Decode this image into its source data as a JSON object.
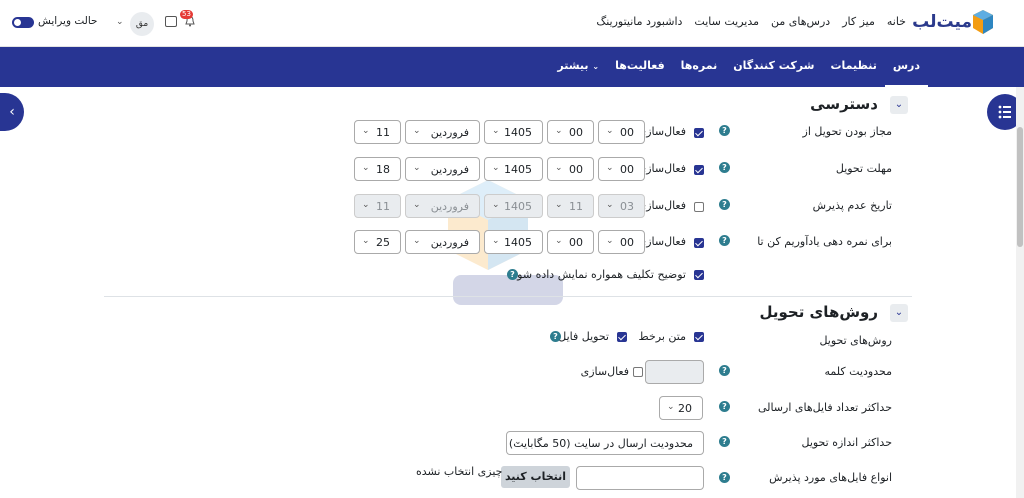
{
  "topbar": {
    "logo_text": "میت‌لب",
    "links": [
      "خانه",
      "میز کار",
      "درس‌های من",
      "مدیریت سایت",
      "داشبورد مانیتورینگ"
    ],
    "edit_mode_label": "حالت ویرایش",
    "avatar_initials": "مق",
    "notification_count": "53"
  },
  "nav": {
    "items": [
      "درس",
      "تنظیمات",
      "شرکت کنندگان",
      "نمره‌ها",
      "فعالیت‌ها",
      "بیشتر"
    ],
    "active": "درس"
  },
  "availability": {
    "title": "دسترسی",
    "enable_label": "فعال‌سازی",
    "rows": [
      {
        "label": "مجاز بودن تحویل از",
        "enabled": true,
        "day": "11",
        "month": "فروردین",
        "year": "1405",
        "hour": "00",
        "minute": "00",
        "disabled": false
      },
      {
        "label": "مهلت تحویل",
        "enabled": true,
        "day": "18",
        "month": "فروردین",
        "year": "1405",
        "hour": "00",
        "minute": "00",
        "disabled": false
      },
      {
        "label": "تاریخ عدم پذیرش",
        "enabled": false,
        "day": "11",
        "month": "فروردین",
        "year": "1405",
        "hour": "11",
        "minute": "03",
        "disabled": true
      },
      {
        "label": "برای نمره دهی یادآوریم کن تا",
        "enabled": true,
        "day": "25",
        "month": "فروردین",
        "year": "1405",
        "hour": "00",
        "minute": "00",
        "disabled": false
      }
    ],
    "always_show_label": "توضیح تکلیف همواره نمایش داده شود"
  },
  "submission": {
    "title": "روش‌های تحویل",
    "types_label": "روش‌های تحویل",
    "online_text_label": "متن برخط",
    "file_submission_label": "تحویل فایل",
    "word_limit_label": "محدودیت کلمه",
    "word_limit_enable_label": "فعال‌سازی",
    "max_files_label": "حداکثر تعداد فایل‌های ارسالی",
    "max_files_value": "20",
    "max_size_label": "حداکثر اندازه تحویل",
    "max_size_value": "محدودیت ارسال در سایت (50 مگابایت)",
    "accepted_types_label": "انواع فایل‌های مورد پذیرش",
    "choose_button": "انتخاب کنید",
    "nothing_selected": "چیزی انتخاب نشده"
  },
  "colors": {
    "primary": "#283593",
    "help": "#2e7d8f",
    "badge": "#e53935"
  },
  "icons": [
    "menu-list-icon",
    "chevron-left-icon",
    "bell-icon",
    "chat-icon",
    "help-icon",
    "chevron-down-icon"
  ]
}
